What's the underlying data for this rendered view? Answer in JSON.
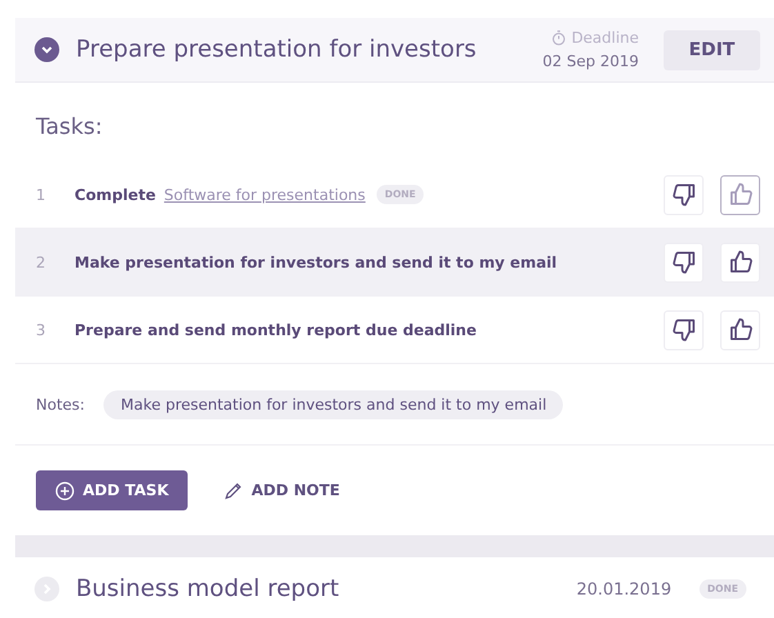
{
  "project": {
    "title": "Prepare presentation for investors",
    "expanded": true,
    "deadline_label": "Deadline",
    "deadline": "02 Sep 2019",
    "edit_button": "EDIT"
  },
  "tasks_heading": "Tasks:",
  "tasks": [
    {
      "number": "1",
      "text": "Complete",
      "link": "Software for presentations",
      "badge": "DONE",
      "selected": false,
      "liked": true
    },
    {
      "number": "2",
      "text": "Make presentation for investors and send it to my email",
      "selected": true,
      "liked": false
    },
    {
      "number": "3",
      "text": "Prepare and send monthly report due deadline",
      "selected": false,
      "liked": false
    }
  ],
  "notes": {
    "label": "Notes:",
    "items": [
      "Make presentation for investors and send it to my email"
    ]
  },
  "actions": {
    "add_task": "ADD TASK",
    "add_note": "ADD NOTE"
  },
  "next_project": {
    "title": "Business model report",
    "expanded": false,
    "date": "20.01.2019",
    "badge": "DONE"
  }
}
